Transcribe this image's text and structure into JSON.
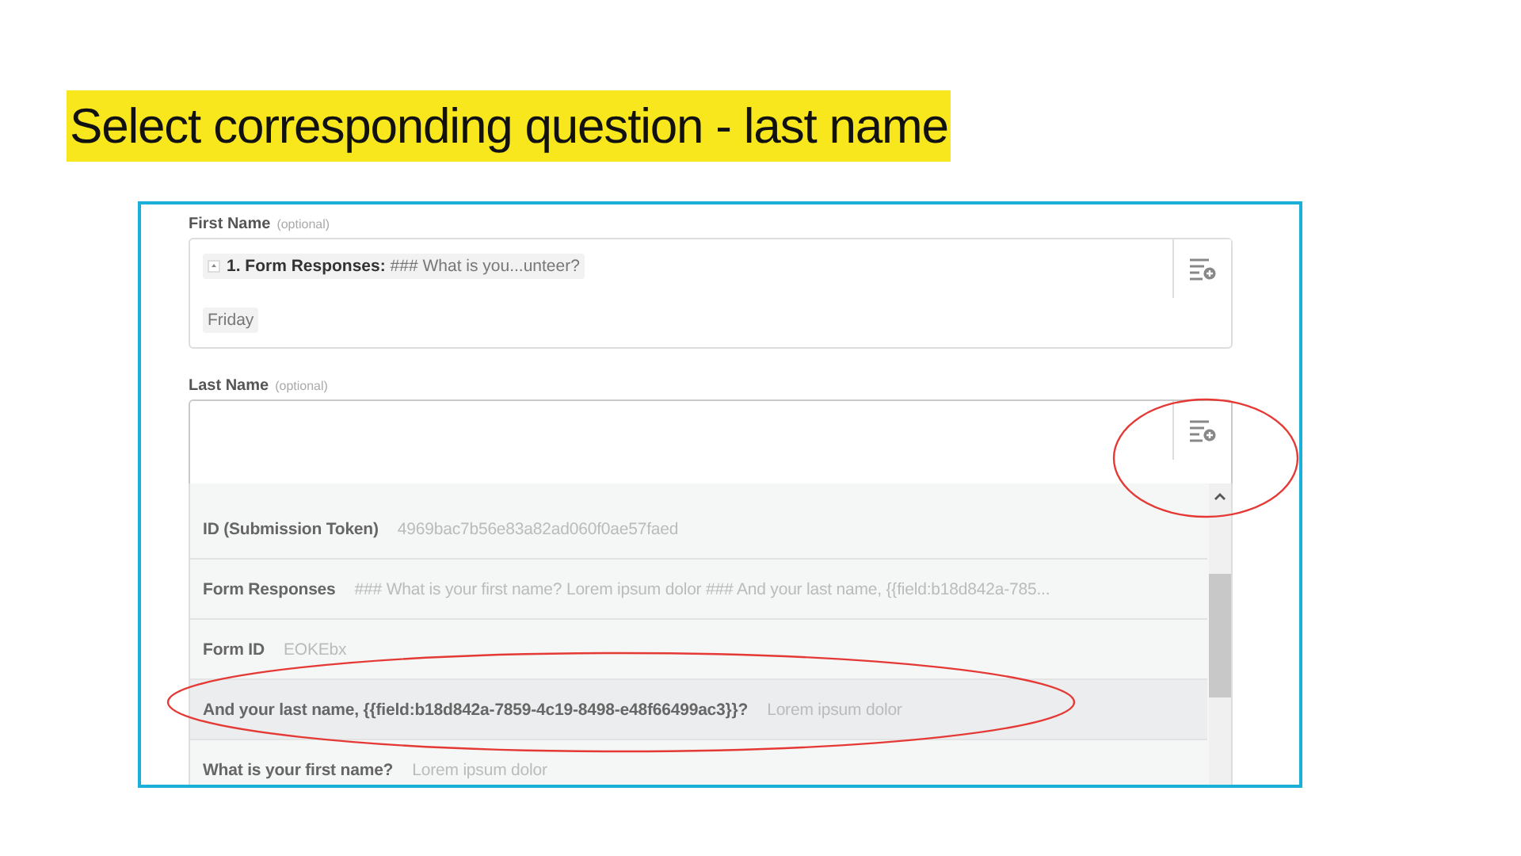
{
  "slide_title": "Select corresponding question - last name",
  "fields": [
    {
      "label": "First Name",
      "hint": "(optional)",
      "dropdown_open": false,
      "tokens": [
        {
          "kind": "mapped",
          "source": "1. Form Responses:",
          "value": "### What is you...unteer?"
        },
        {
          "kind": "text",
          "value": "Friday"
        }
      ]
    },
    {
      "label": "Last Name",
      "hint": "(optional)",
      "dropdown_open": true,
      "options": [
        {
          "key": "ID (Submission Token)",
          "value": "4969bac7b56e83a82ad060f0ae57faed",
          "selected": false
        },
        {
          "key": "Form Responses",
          "value": "### What is your first name? Lorem ipsum dolor ### And your last name, {{field:b18d842a-785...",
          "selected": false
        },
        {
          "key": "Form ID",
          "value": "EOKEbx",
          "selected": false
        },
        {
          "key": "And your last name, {{field:b18d842a-7859-4c19-8498-e48f66499ac3}}?",
          "value": "Lorem ipsum dolor",
          "selected": true
        },
        {
          "key": "What is your first name?",
          "value": "Lorem ipsum dolor",
          "selected": false
        }
      ]
    }
  ]
}
